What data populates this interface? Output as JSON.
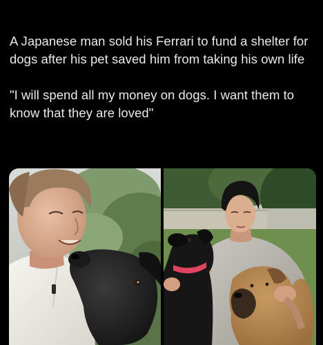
{
  "post": {
    "paragraphs": [
      "A Japanese man sold his Ferrari to fund a shelter for dogs after his pet saved him from taking his own life",
      "\"I will spend all my money on dogs. I want them to know that they are loved\""
    ]
  },
  "media": {
    "photos": [
      {
        "subject": "man smiling with black dog"
      },
      {
        "subject": "man kneeling with black dog and tan dog"
      }
    ]
  },
  "colors": {
    "background": "#000000",
    "text": "#e7e9ea",
    "collar": "#e0435f"
  }
}
